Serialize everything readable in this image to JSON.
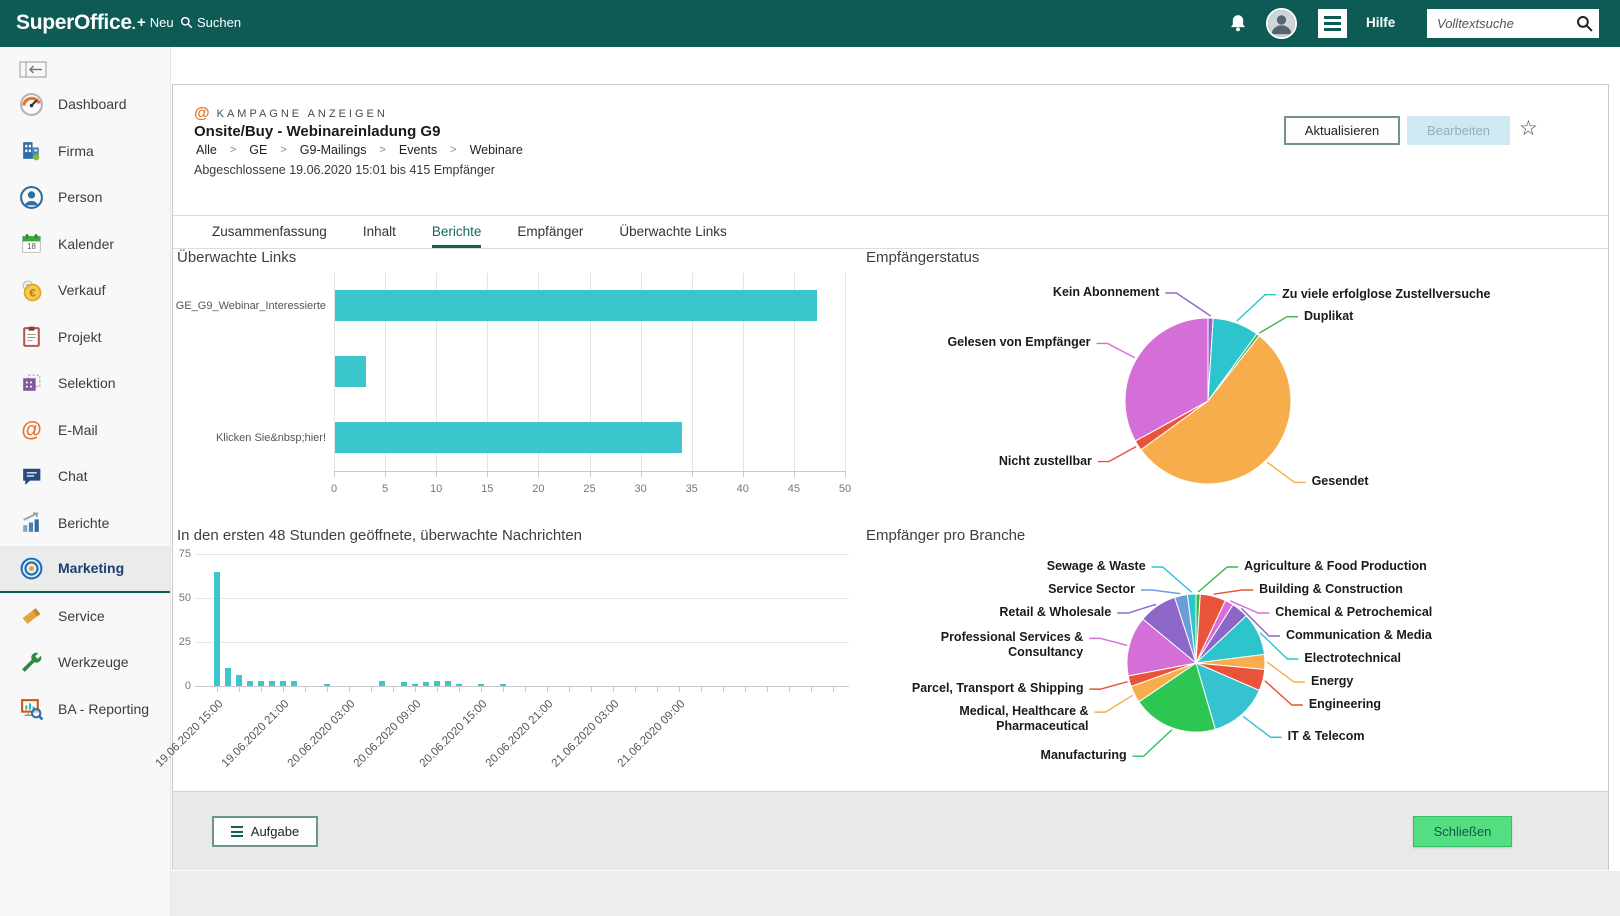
{
  "topbar": {
    "brand": "SuperOffice",
    "brand_dot": ".",
    "new_label": "Neu",
    "search_label": "Suchen",
    "help_label": "Hilfe",
    "fulltext_placeholder": "Volltextsuche"
  },
  "icons": {
    "star": "☆",
    "plus": "+"
  },
  "sidebar": {
    "items": [
      {
        "label": "Dashboard"
      },
      {
        "label": "Firma"
      },
      {
        "label": "Person"
      },
      {
        "label": "Kalender"
      },
      {
        "label": "Verkauf"
      },
      {
        "label": "Projekt"
      },
      {
        "label": "Selektion"
      },
      {
        "label": "E-Mail"
      },
      {
        "label": "Chat"
      },
      {
        "label": "Berichte"
      },
      {
        "label": "Marketing"
      },
      {
        "label": "Service"
      },
      {
        "label": "Werkzeuge"
      },
      {
        "label": "BA - Reporting"
      }
    ]
  },
  "campaign": {
    "kicker": "KAMPAGNE ANZEIGEN",
    "title": "Onsite/Buy - Webinareinladung G9",
    "breadcrumb": [
      "Alle",
      "GE",
      "G9-Mailings",
      "Events",
      "Webinare"
    ],
    "separator": ">",
    "status_line": "Abgeschlossene 19.06.2020 15:01 bis 415 Empfänger",
    "refresh_label": "Aktualisieren",
    "edit_label": "Bearbeiten"
  },
  "tabs": {
    "items": [
      {
        "label": "Zusammenfassung"
      },
      {
        "label": "Inhalt"
      },
      {
        "label": "Berichte"
      },
      {
        "label": "Empfänger"
      },
      {
        "label": "Überwachte Links"
      }
    ],
    "active": "Berichte"
  },
  "footer": {
    "task_label": "Aufgabe",
    "close_label": "Schließen"
  },
  "chart_data": [
    {
      "type": "bar",
      "orientation": "horizontal",
      "title": "Überwachte Links",
      "categories": [
        "GE_G9_Webinar_Interessierte",
        "",
        "Klicken Sie&nbsp;hier!"
      ],
      "values": [
        47.2,
        3,
        34
      ],
      "xlim": [
        0,
        50
      ],
      "xticks": [
        0,
        5,
        10,
        15,
        20,
        25,
        30,
        35,
        40,
        45,
        50
      ],
      "bar_color": "#3bc6cd",
      "grid": true
    },
    {
      "type": "pie",
      "title": "Empfängerstatus",
      "slices": [
        {
          "label": "Kein Abonnement",
          "value": 1,
          "color": "#9a65c9",
          "side": "left"
        },
        {
          "label": "Zu viele erfolglose Zustellversuche",
          "value": 9,
          "color": "#2cc4cd",
          "side": "right"
        },
        {
          "label": "Duplikat",
          "value": 0.6,
          "color": "#3bb54a",
          "side": "right"
        },
        {
          "label": "Gesendet",
          "value": 54.4,
          "color": "#f8ad4c",
          "side": "right"
        },
        {
          "label": "Nicht zustellbar",
          "value": 2,
          "color": "#e8533a",
          "side": "left"
        },
        {
          "label": "Gelesen von Empfänger",
          "value": 33,
          "color": "#d56fd8",
          "side": "left"
        }
      ]
    },
    {
      "type": "bar",
      "orientation": "vertical",
      "title": "In den ersten 48 Stunden geöffnete, überwachte Nachrichten",
      "values": [
        65,
        10,
        6,
        3,
        3,
        3,
        3,
        3,
        0,
        0,
        1,
        0,
        0,
        0,
        0,
        3,
        0,
        2,
        1,
        2,
        3,
        3,
        1,
        0,
        1,
        0,
        1,
        0,
        0,
        0,
        0,
        0,
        0,
        0,
        0,
        0,
        0,
        0,
        0,
        0,
        0,
        0,
        0,
        0,
        0,
        0,
        0,
        0
      ],
      "ylim": [
        0,
        75
      ],
      "yticks": [
        0,
        25,
        50,
        75
      ],
      "xtick_labels": [
        {
          "slot": 0,
          "label": "19.06.2020 15:00"
        },
        {
          "slot": 6,
          "label": "19.06.2020 21:00"
        },
        {
          "slot": 12,
          "label": "20.06.2020 03:00"
        },
        {
          "slot": 18,
          "label": "20.06.2020 09:00"
        },
        {
          "slot": 24,
          "label": "20.06.2020 15:00"
        },
        {
          "slot": 30,
          "label": "20.06.2020 21:00"
        },
        {
          "slot": 36,
          "label": "21.06.2020 03:00"
        },
        {
          "slot": 42,
          "label": "21.06.2020 09:00"
        }
      ],
      "bar_color": "#3bc6cd",
      "grid": true
    },
    {
      "type": "pie",
      "title": "Empfänger pro Branche",
      "slices": [
        {
          "label": "Agriculture & Food Production",
          "value": 1,
          "color": "#3bb54a"
        },
        {
          "label": "Building & Construction",
          "value": 6,
          "color": "#e8533a"
        },
        {
          "label": "Chemical & Petrochemical",
          "value": 2,
          "color": "#d56fd8"
        },
        {
          "label": "Communication & Media",
          "value": 4,
          "color": "#8d67c8"
        },
        {
          "label": "Electrotechnical",
          "value": 10,
          "color": "#2cc4cd"
        },
        {
          "label": "Energy",
          "value": 3.5,
          "color": "#f8ad4c"
        },
        {
          "label": "Engineering",
          "value": 5,
          "color": "#e8533a"
        },
        {
          "label": "IT & Telecom",
          "value": 14,
          "color": "#35c4cf"
        },
        {
          "label": "Manufacturing",
          "value": 20,
          "color": "#2dc653"
        },
        {
          "label": "Medical, Healthcare & Pharmaceutical",
          "value": 4,
          "color": "#f8ad4c"
        },
        {
          "label": "Parcel, Transport & Shipping",
          "value": 2.5,
          "color": "#e8533a"
        },
        {
          "label": "Professional Services & Consultancy",
          "value": 14,
          "color": "#d56fd8"
        },
        {
          "label": "Retail & Wholesale",
          "value": 9,
          "color": "#8d67c8"
        },
        {
          "label": "Service Sector",
          "value": 3,
          "color": "#6b9bd8"
        },
        {
          "label": "Sewage & Waste",
          "value": 2,
          "color": "#2cc4cd"
        }
      ]
    }
  ]
}
